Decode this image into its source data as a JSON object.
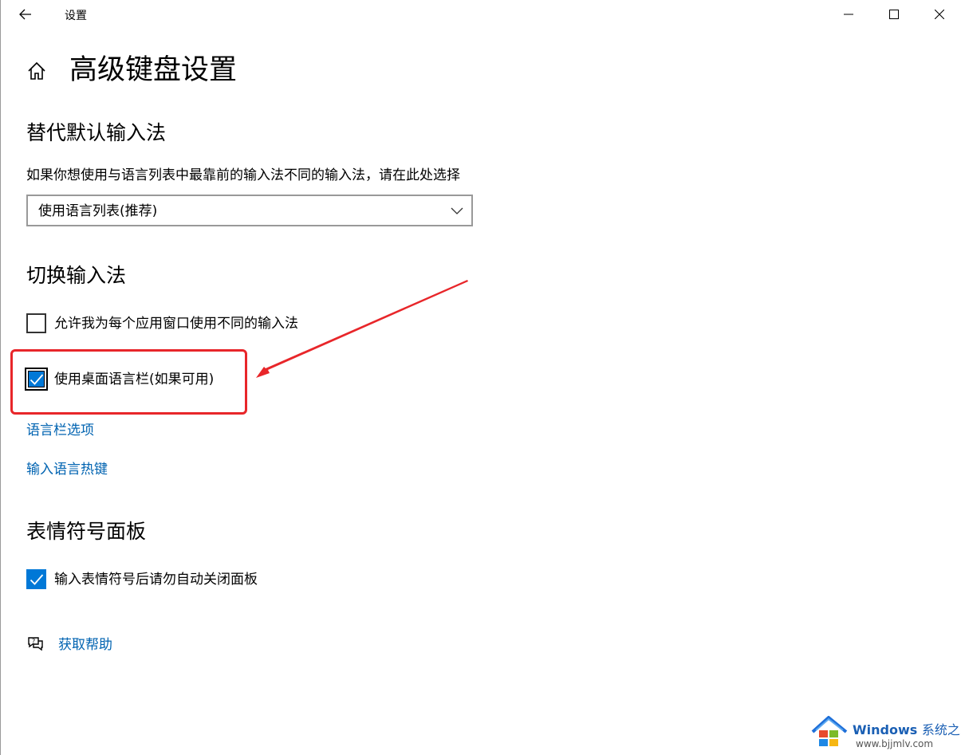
{
  "window": {
    "title": "设置"
  },
  "page": {
    "title": "高级键盘设置"
  },
  "sections": {
    "default_input": {
      "title": "替代默认输入法",
      "description": "如果你想使用与语言列表中最靠前的输入法不同的输入法，请在此处选择",
      "dropdown_value": "使用语言列表(推荐)"
    },
    "switch_input": {
      "title": "切换输入法",
      "checkbox_per_app": {
        "label": "允许我为每个应用窗口使用不同的输入法",
        "checked": false
      },
      "checkbox_language_bar": {
        "label": "使用桌面语言栏(如果可用)",
        "checked": true
      },
      "link_language_bar_options": "语言栏选项",
      "link_input_hotkeys": "输入语言热键"
    },
    "emoji_panel": {
      "title": "表情符号面板",
      "checkbox_auto_close": {
        "label": "输入表情符号后请勿自动关闭面板",
        "checked": true
      }
    }
  },
  "help": {
    "label": "获取帮助"
  },
  "watermark": {
    "brand_en": "Windows",
    "brand_cn": "系统之家",
    "url": "www.bjjmlv.com"
  },
  "colors": {
    "accent": "#0078d7",
    "link": "#0063b1",
    "annotation": "#e8262a"
  },
  "icons": {
    "back": "back-arrow-icon",
    "home": "home-icon",
    "minimize": "minimize-icon",
    "maximize": "maximize-icon",
    "close": "close-icon",
    "chevron": "chevron-down-icon",
    "help": "help-chat-icon",
    "check": "checkmark-icon"
  }
}
